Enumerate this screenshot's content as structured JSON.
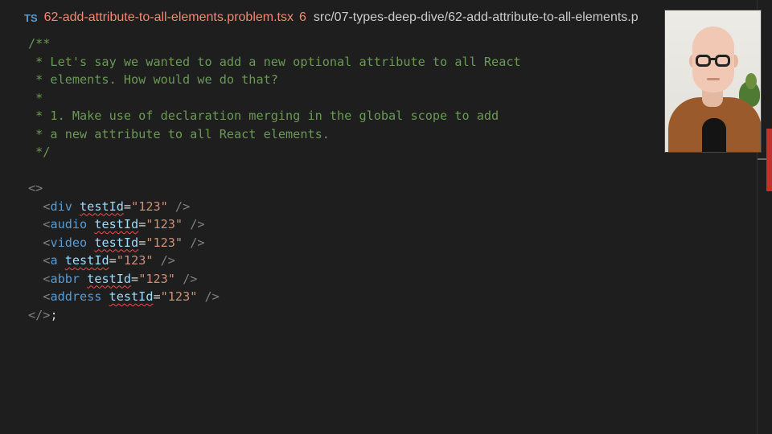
{
  "tab": {
    "language_badge": "TS",
    "filename": "62-add-attribute-to-all-elements.problem.tsx",
    "error_count": "6",
    "path": "src/07-types-deep-dive/62-add-attribute-to-all-elements.p"
  },
  "code": {
    "comment_lines": [
      "/**",
      " * Let's say we wanted to add a new optional attribute to all React",
      " * elements. How would we do that?",
      " *",
      " * 1. Make use of declaration merging in the global scope to add",
      " * a new attribute to all React elements.",
      " */"
    ],
    "fragment_open": "<>",
    "fragment_close": "</>",
    "terminator": ";",
    "jsx_lines": [
      {
        "tag": "div",
        "attr": "testId",
        "value": "\"123\""
      },
      {
        "tag": "audio",
        "attr": "testId",
        "value": "\"123\""
      },
      {
        "tag": "video",
        "attr": "testId",
        "value": "\"123\""
      },
      {
        "tag": "a",
        "attr": "testId",
        "value": "\"123\""
      },
      {
        "tag": "abbr",
        "attr": "testId",
        "value": "\"123\""
      },
      {
        "tag": "address",
        "attr": "testId",
        "value": "\"123\""
      }
    ]
  },
  "colors": {
    "editor_bg": "#1e1e1e",
    "comment": "#6a9955",
    "tag": "#569cd6",
    "attribute": "#9cdcfe",
    "string": "#ce9178",
    "error": "#f48771"
  },
  "icons": {
    "language": "typescript-icon"
  }
}
